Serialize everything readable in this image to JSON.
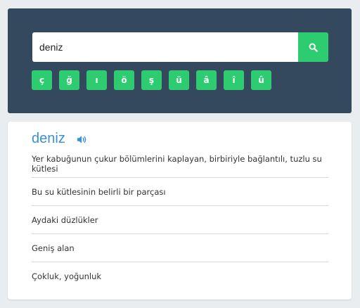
{
  "search": {
    "value": "deniz",
    "button_icon": "search-icon"
  },
  "special_chars": [
    "ç",
    "ğ",
    "ı",
    "ö",
    "ş",
    "ü",
    "â",
    "î",
    "û"
  ],
  "result": {
    "word": "deniz",
    "audio_icon": "speaker-icon",
    "meanings": [
      "Yer kabuğunun çukur bölümlerini kaplayan, birbiriyle bağlantılı, tuzlu su kütlesi",
      "Bu su kütlesinin belirli bir parçası",
      "Aydaki düzlükler",
      "Geniş alan",
      "Çokluk, yoğunluk"
    ]
  },
  "colors": {
    "panel": "#34495e",
    "accent_green": "#2ecc71",
    "word_blue": "#3a8fd6",
    "background": "#e9edf0"
  }
}
